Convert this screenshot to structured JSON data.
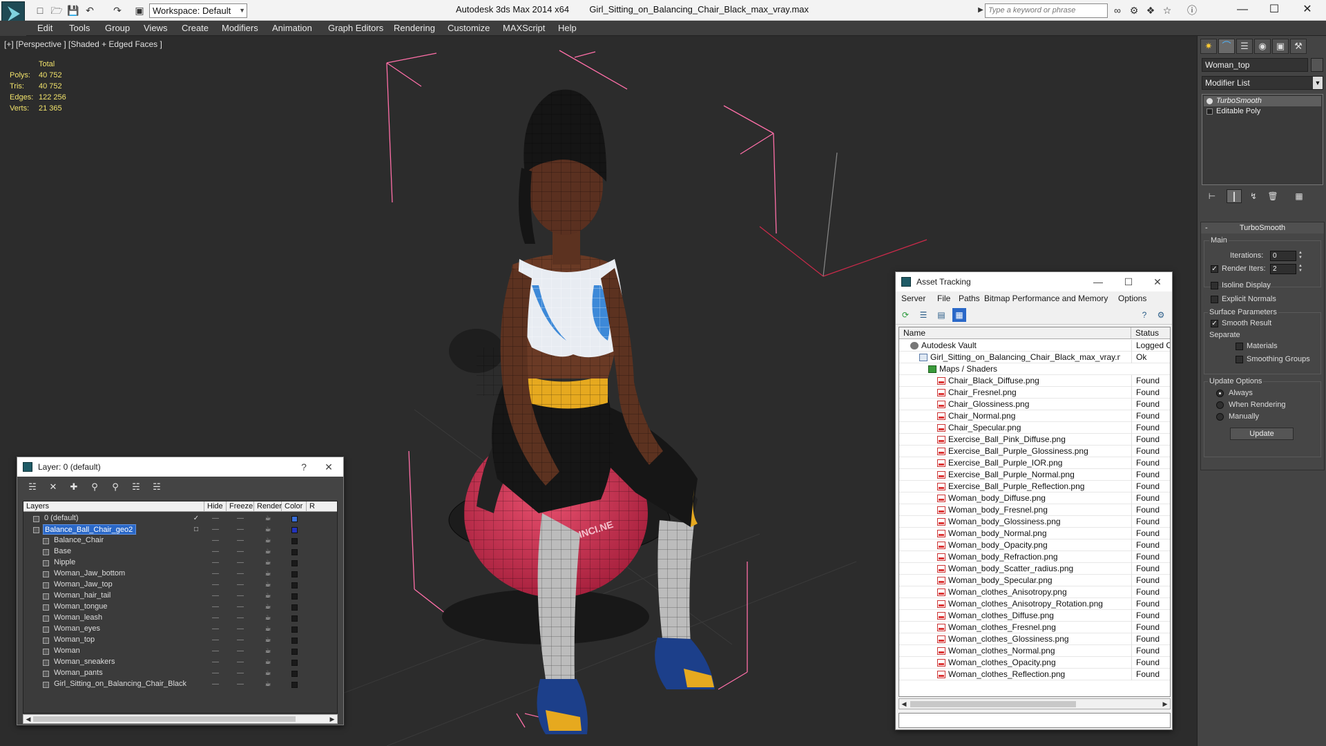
{
  "titlebar": {
    "workspace_label": "Workspace: Default",
    "app_name": "Autodesk 3ds Max  2014 x64",
    "file_name": "Girl_Sitting_on_Balancing_Chair_Black_max_vray.max",
    "search_placeholder": "Type a keyword or phrase"
  },
  "menu": [
    "Edit",
    "Tools",
    "Group",
    "Views",
    "Create",
    "Modifiers",
    "Animation",
    "Graph Editors",
    "Rendering",
    "Customize",
    "MAXScript",
    "Help"
  ],
  "viewport": {
    "label": "[+] [Perspective ] [Shaded + Edged Faces ]",
    "stats_header": "Total",
    "stats": [
      {
        "label": "Polys:",
        "value": "40 752"
      },
      {
        "label": "Tris:",
        "value": "40 752"
      },
      {
        "label": "Edges:",
        "value": "122 256"
      },
      {
        "label": "Verts:",
        "value": "21 365"
      }
    ],
    "ball_text": "INCI.NE"
  },
  "command_panel": {
    "object_name": "Woman_top",
    "modifier_list": "Modifier List",
    "stack": [
      "TurboSmooth",
      "Editable Poly"
    ],
    "turbosmooth": {
      "title": "TurboSmooth",
      "main_label": "Main",
      "iterations_label": "Iterations:",
      "iterations_value": "0",
      "render_iters_label": "Render Iters:",
      "render_iters_value": "2",
      "isoline_label": "Isoline Display",
      "explicit_label": "Explicit Normals",
      "surface_label": "Surface Parameters",
      "smooth_label": "Smooth Result",
      "separate_label": "Separate",
      "materials_label": "Materials",
      "smoothing_groups_label": "Smoothing Groups",
      "update_options_label": "Update Options",
      "always_label": "Always",
      "when_rendering_label": "When Rendering",
      "manually_label": "Manually",
      "update_button": "Update"
    }
  },
  "layer_dialog": {
    "title": "Layer: 0 (default)",
    "columns": [
      "Layers",
      "Hide",
      "Freeze",
      "Render",
      "Color",
      "R"
    ],
    "rows": [
      {
        "name": "0 (default)",
        "level": 0,
        "color": "#3a6fd8",
        "selected": false
      },
      {
        "name": "Balance_Ball_Chair_geo2",
        "level": 0,
        "color": "#2233bb",
        "selected": true
      },
      {
        "name": "Balance_Chair",
        "level": 1,
        "color": "#1a1a1a",
        "selected": false
      },
      {
        "name": "Base",
        "level": 1,
        "color": "#1a1a1a",
        "selected": false
      },
      {
        "name": "Nipple",
        "level": 1,
        "color": "#1a1a1a",
        "selected": false
      },
      {
        "name": "Woman_Jaw_bottom",
        "level": 1,
        "color": "#1a1a1a",
        "selected": false
      },
      {
        "name": "Woman_Jaw_top",
        "level": 1,
        "color": "#1a1a1a",
        "selected": false
      },
      {
        "name": "Woman_hair_tail",
        "level": 1,
        "color": "#1a1a1a",
        "selected": false
      },
      {
        "name": "Woman_tongue",
        "level": 1,
        "color": "#1a1a1a",
        "selected": false
      },
      {
        "name": "Woman_leash",
        "level": 1,
        "color": "#1a1a1a",
        "selected": false
      },
      {
        "name": "Woman_eyes",
        "level": 1,
        "color": "#1a1a1a",
        "selected": false
      },
      {
        "name": "Woman_top",
        "level": 1,
        "color": "#1a1a1a",
        "selected": false
      },
      {
        "name": "Woman",
        "level": 1,
        "color": "#1a1a1a",
        "selected": false
      },
      {
        "name": "Woman_sneakers",
        "level": 1,
        "color": "#1a1a1a",
        "selected": false
      },
      {
        "name": "Woman_pants",
        "level": 1,
        "color": "#1a1a1a",
        "selected": false
      },
      {
        "name": "Girl_Sitting_on_Balancing_Chair_Black",
        "level": 1,
        "color": "#1a1a1a",
        "selected": false
      }
    ]
  },
  "asset_dialog": {
    "title": "Asset Tracking",
    "menu": [
      "Server",
      "File",
      "Paths",
      "Bitmap Performance and Memory",
      "Options"
    ],
    "columns": [
      "Name",
      "Status"
    ],
    "rows": [
      {
        "name": "Autodesk Vault",
        "status": "Logged Out",
        "level": 0,
        "icon": "vault"
      },
      {
        "name": "Girl_Sitting_on_Balancing_Chair_Black_max_vray.max",
        "status": "Ok",
        "level": 1,
        "icon": "max"
      },
      {
        "name": "Maps / Shaders",
        "status": "",
        "level": 2,
        "icon": "folder"
      },
      {
        "name": "Chair_Black_Diffuse.png",
        "status": "Found",
        "level": 3,
        "icon": "png"
      },
      {
        "name": "Chair_Fresnel.png",
        "status": "Found",
        "level": 3,
        "icon": "png"
      },
      {
        "name": "Chair_Glossiness.png",
        "status": "Found",
        "level": 3,
        "icon": "png"
      },
      {
        "name": "Chair_Normal.png",
        "status": "Found",
        "level": 3,
        "icon": "png"
      },
      {
        "name": "Chair_Specular.png",
        "status": "Found",
        "level": 3,
        "icon": "png"
      },
      {
        "name": "Exercise_Ball_Pink_Diffuse.png",
        "status": "Found",
        "level": 3,
        "icon": "png"
      },
      {
        "name": "Exercise_Ball_Purple_Glossiness.png",
        "status": "Found",
        "level": 3,
        "icon": "png"
      },
      {
        "name": "Exercise_Ball_Purple_IOR.png",
        "status": "Found",
        "level": 3,
        "icon": "png"
      },
      {
        "name": "Exercise_Ball_Purple_Normal.png",
        "status": "Found",
        "level": 3,
        "icon": "png"
      },
      {
        "name": "Exercise_Ball_Purple_Reflection.png",
        "status": "Found",
        "level": 3,
        "icon": "png"
      },
      {
        "name": "Woman_body_Diffuse.png",
        "status": "Found",
        "level": 3,
        "icon": "png"
      },
      {
        "name": "Woman_body_Fresnel.png",
        "status": "Found",
        "level": 3,
        "icon": "png"
      },
      {
        "name": "Woman_body_Glossiness.png",
        "status": "Found",
        "level": 3,
        "icon": "png"
      },
      {
        "name": "Woman_body_Normal.png",
        "status": "Found",
        "level": 3,
        "icon": "png"
      },
      {
        "name": "Woman_body_Opacity.png",
        "status": "Found",
        "level": 3,
        "icon": "png"
      },
      {
        "name": "Woman_body_Refraction.png",
        "status": "Found",
        "level": 3,
        "icon": "png"
      },
      {
        "name": "Woman_body_Scatter_radius.png",
        "status": "Found",
        "level": 3,
        "icon": "png"
      },
      {
        "name": "Woman_body_Specular.png",
        "status": "Found",
        "level": 3,
        "icon": "png"
      },
      {
        "name": "Woman_clothes_Anisotropy.png",
        "status": "Found",
        "level": 3,
        "icon": "png"
      },
      {
        "name": "Woman_clothes_Anisotropy_Rotation.png",
        "status": "Found",
        "level": 3,
        "icon": "png"
      },
      {
        "name": "Woman_clothes_Diffuse.png",
        "status": "Found",
        "level": 3,
        "icon": "png"
      },
      {
        "name": "Woman_clothes_Fresnel.png",
        "status": "Found",
        "level": 3,
        "icon": "png"
      },
      {
        "name": "Woman_clothes_Glossiness.png",
        "status": "Found",
        "level": 3,
        "icon": "png"
      },
      {
        "name": "Woman_clothes_Normal.png",
        "status": "Found",
        "level": 3,
        "icon": "png"
      },
      {
        "name": "Woman_clothes_Opacity.png",
        "status": "Found",
        "level": 3,
        "icon": "png"
      },
      {
        "name": "Woman_clothes_Reflection.png",
        "status": "Found",
        "level": 3,
        "icon": "png"
      }
    ]
  },
  "colors": {
    "viewport_bg": "#2c2c2c",
    "stats_text": "#f2e36b",
    "selection_blue": "#2a68c8",
    "bounding_box_pink": "#ff6fa8",
    "ball_pink": "#d9365a"
  }
}
